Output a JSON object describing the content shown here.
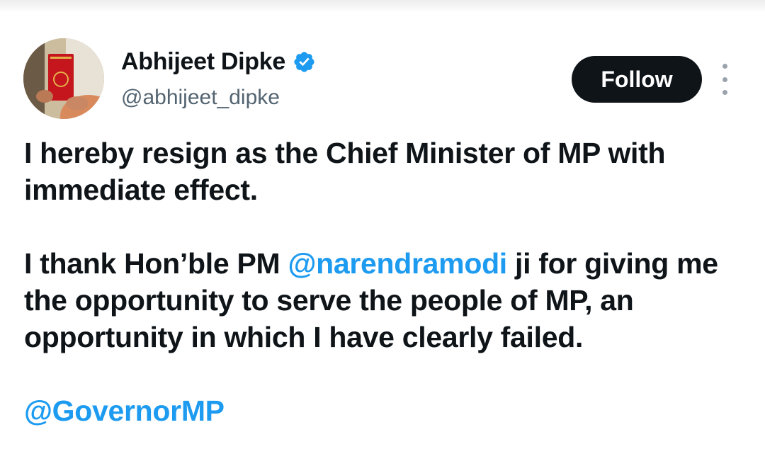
{
  "author": {
    "display_name": "Abhijeet Dipke",
    "handle": "@abhijeet_dipke",
    "verified": true,
    "avatar_icon": "profile-photo-holding-red-book"
  },
  "actions": {
    "follow_label": "Follow",
    "more_icon": "more-vertical-icon"
  },
  "tweet": {
    "para1": "I hereby resign as the Chief Minister of MP with immediate effect.",
    "para2_pre": "I thank Hon’ble PM ",
    "para2_mention": "@narendramodi",
    "para2_post": " ji for giving me the opportunity to serve the people of MP, an opportunity in which I have clearly failed.",
    "para3_mention": "@GovernorMP"
  },
  "colors": {
    "text": "#0f1419",
    "secondary": "#536471",
    "link": "#1d9bf0",
    "button_bg": "#0f1419",
    "button_text": "#ffffff"
  }
}
